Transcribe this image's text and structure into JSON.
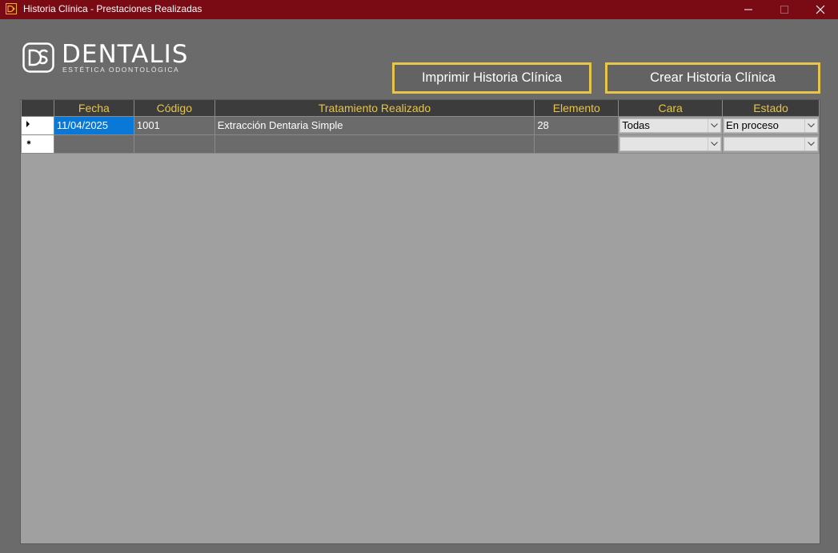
{
  "window": {
    "title": "Historia Clínica - Prestaciones Realizadas"
  },
  "logo": {
    "name": "DENTALIS",
    "subtitle": "ESTÉTICA ODONTOLÓGICA"
  },
  "toolbar": {
    "print_label": "Imprimir Historia Clínica",
    "create_label": "Crear Historia Clínica"
  },
  "table": {
    "columns": [
      "Fecha",
      "Código",
      "Tratamiento Realizado",
      "Elemento",
      "Cara",
      "Estado"
    ],
    "rows": [
      {
        "fecha": "11/04/2025",
        "codigo": "1001",
        "tratamiento": "Extracción Dentaria Simple",
        "elemento": "28",
        "cara": "Todas",
        "estado": "En proceso"
      },
      {
        "fecha": "",
        "codigo": "",
        "tratamiento": "",
        "elemento": "",
        "cara": "",
        "estado": ""
      }
    ]
  },
  "colors": {
    "titlebar": "#7a0a14",
    "accent": "#e7c54a",
    "selection": "#0a78d7",
    "background": "#6b6b6b",
    "grid_bg": "#a0a0a0"
  },
  "icons": {
    "row_current": "triangle-right-icon",
    "row_new": "asterisk-icon"
  }
}
